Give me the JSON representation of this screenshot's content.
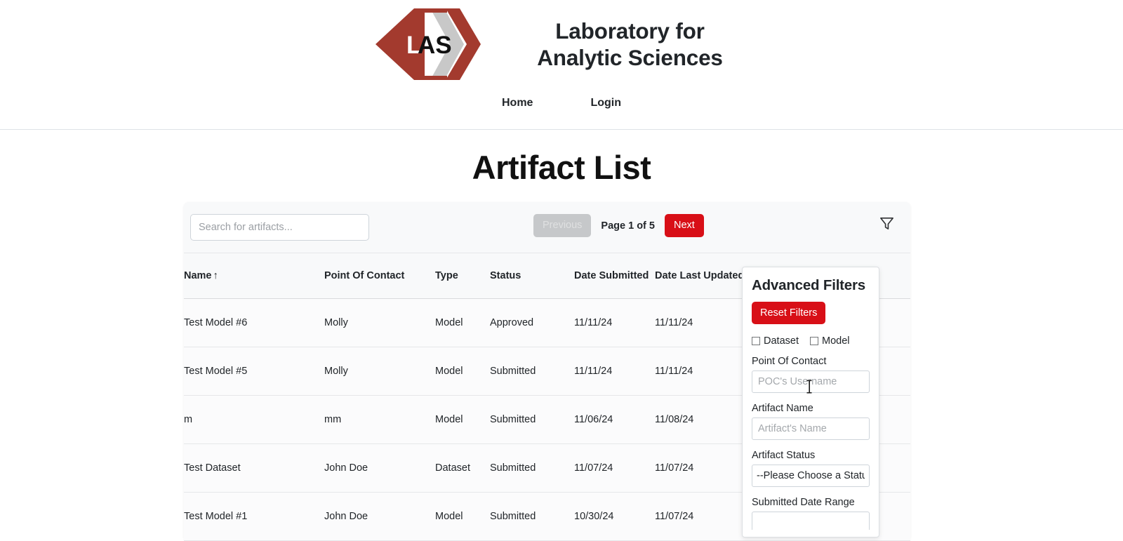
{
  "header": {
    "logo_text": "LAS",
    "logo_name": "las-diamond-chevron-logo",
    "brand_title": "Laboratory for Analytic Sciences",
    "nav": [
      {
        "label": "Home",
        "name": "nav-link-home"
      },
      {
        "label": "Login",
        "name": "nav-link-login"
      }
    ]
  },
  "page": {
    "title": "Artifact List"
  },
  "toolbar": {
    "search_placeholder": "Search for artifacts...",
    "search_value": "",
    "previous_label": "Previous",
    "next_label": "Next",
    "page_indicator": "Page 1 of 5",
    "filter_icon": "funnel-filter-icon"
  },
  "table": {
    "columns": [
      {
        "key": "name",
        "label": "Name",
        "sort": "↑"
      },
      {
        "key": "poc",
        "label": "Point Of Contact",
        "sort": ""
      },
      {
        "key": "type",
        "label": "Type",
        "sort": ""
      },
      {
        "key": "status",
        "label": "Status",
        "sort": ""
      },
      {
        "key": "submitted",
        "label": "Date Submitted",
        "sort": ""
      },
      {
        "key": "updated",
        "label": "Date Last Updated",
        "sort": ""
      }
    ],
    "rows": [
      {
        "name": "Test Model #6",
        "poc": "Molly",
        "type": "Model",
        "status": "Approved",
        "submitted": "11/11/24",
        "updated": "11/11/24"
      },
      {
        "name": "Test Model #5",
        "poc": "Molly",
        "type": "Model",
        "status": "Submitted",
        "submitted": "11/11/24",
        "updated": "11/11/24"
      },
      {
        "name": "m",
        "poc": "mm",
        "type": "Model",
        "status": "Submitted",
        "submitted": "11/06/24",
        "updated": "11/08/24"
      },
      {
        "name": "Test Dataset",
        "poc": "John Doe",
        "type": "Dataset",
        "status": "Submitted",
        "submitted": "11/07/24",
        "updated": "11/07/24"
      },
      {
        "name": "Test Model #1",
        "poc": "John Doe",
        "type": "Model",
        "status": "Submitted",
        "submitted": "10/30/24",
        "updated": "11/07/24"
      }
    ]
  },
  "filters": {
    "title": "Advanced Filters",
    "reset_label": "Reset Filters",
    "checkboxes": [
      {
        "label": "Dataset",
        "checked": false
      },
      {
        "label": "Model",
        "checked": false
      }
    ],
    "poc_label": "Point Of Contact",
    "poc_placeholder": "POC's Username",
    "poc_value": "",
    "artifact_name_label": "Artifact Name",
    "artifact_name_placeholder": "Artifact's Name",
    "artifact_name_value": "",
    "status_label": "Artifact Status",
    "status_selected": "--Please Choose a Status--",
    "date_range_label": "Submitted Date Range"
  },
  "colors": {
    "brand_red": "#d80f17",
    "logo_dark_red": "#a33a2e",
    "logo_gray": "#c8c8c8",
    "card_bg": "#f8f9fa",
    "border": "#dee2e6"
  }
}
